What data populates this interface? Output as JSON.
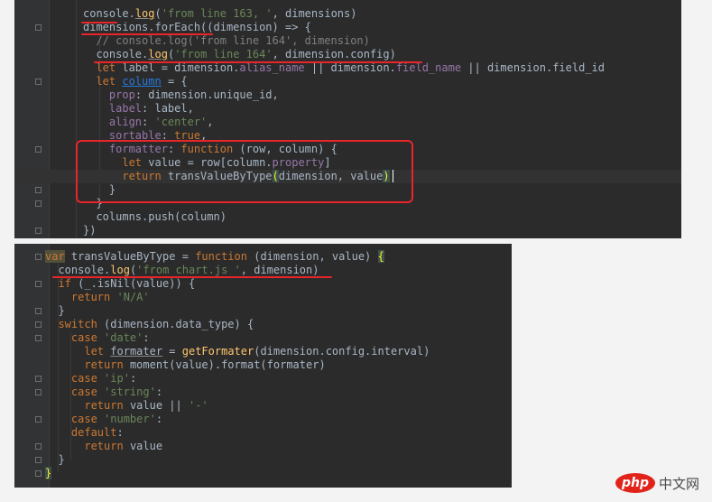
{
  "panels": [
    {
      "id": "top",
      "lines": [
        [
          [
            "plain",
            "console"
          ],
          [
            "plain",
            "."
          ],
          [
            "fn-u",
            "log"
          ],
          [
            "plain",
            "("
          ],
          [
            "str",
            "'from line 163, '"
          ],
          [
            "plain",
            ", dimensions)"
          ]
        ],
        [
          [
            "plain",
            "dimensions.forEach((dimension) => {"
          ]
        ],
        [
          [
            "cm",
            "  // console.log('from line 164', dimension)"
          ]
        ],
        [
          [
            "plain",
            "  "
          ],
          [
            "plain",
            "console"
          ],
          [
            "plain",
            "."
          ],
          [
            "fn-u",
            "log"
          ],
          [
            "plain",
            "("
          ],
          [
            "str",
            "'from line 164'"
          ],
          [
            "plain",
            ", dimension.config)"
          ]
        ],
        [
          [
            "plain",
            "  "
          ],
          [
            "kw",
            "let "
          ],
          [
            "plain",
            "label = dimension."
          ],
          [
            "prop",
            "alias_name"
          ],
          [
            "plain",
            " || dimension."
          ],
          [
            "prop",
            "field_name"
          ],
          [
            "plain",
            " || dimension.field_id"
          ]
        ],
        [
          [
            "plain",
            "  "
          ],
          [
            "kw",
            "let "
          ],
          [
            "link",
            "column"
          ],
          [
            "plain",
            " = {"
          ]
        ],
        [
          [
            "plain",
            "    "
          ],
          [
            "prop",
            "prop"
          ],
          [
            "plain",
            ": dimension.unique_id,"
          ]
        ],
        [
          [
            "plain",
            "    "
          ],
          [
            "prop",
            "label"
          ],
          [
            "plain",
            ": label,"
          ]
        ],
        [
          [
            "plain",
            "    "
          ],
          [
            "prop",
            "align"
          ],
          [
            "plain",
            ": "
          ],
          [
            "str",
            "'center'"
          ],
          [
            "plain",
            ","
          ]
        ],
        [
          [
            "plain",
            "    "
          ],
          [
            "prop",
            "sortable"
          ],
          [
            "plain",
            ": "
          ],
          [
            "kw",
            "true"
          ],
          [
            "plain",
            ","
          ]
        ],
        [
          [
            "plain",
            "    "
          ],
          [
            "prop",
            "formatter"
          ],
          [
            "plain",
            ": "
          ],
          [
            "kw",
            "function "
          ],
          [
            "plain",
            "(row, column) {"
          ]
        ],
        [
          [
            "plain",
            "      "
          ],
          [
            "kw",
            "let "
          ],
          [
            "plain",
            "value = row[column."
          ],
          [
            "prop",
            "property"
          ],
          [
            "plain",
            "]"
          ]
        ],
        [
          [
            "plain",
            "      "
          ],
          [
            "kw",
            "return "
          ],
          [
            "plain",
            "transValueByType"
          ],
          [
            "hl",
            "("
          ],
          [
            "plain",
            "dimension, value"
          ],
          [
            "hl",
            ")"
          ]
        ],
        [
          [
            "plain",
            "    }"
          ]
        ],
        [
          [
            "plain",
            "  }"
          ]
        ],
        [
          [
            "plain",
            "  columns.push(column)"
          ]
        ],
        [
          [
            "plain",
            "})"
          ]
        ]
      ]
    },
    {
      "id": "bottom",
      "lines": [
        [
          [
            "kw-warn",
            "var"
          ],
          [
            "plain",
            " transValueByType = "
          ],
          [
            "kw",
            "function "
          ],
          [
            "plain",
            "(dimension, value) "
          ],
          [
            "hl",
            "{"
          ]
        ],
        [
          [
            "plain",
            "  console."
          ],
          [
            "fn",
            "log"
          ],
          [
            "plain",
            "("
          ],
          [
            "str",
            "'from chart.js '"
          ],
          [
            "plain",
            ", dimension)"
          ]
        ],
        [
          [
            "plain",
            "  "
          ],
          [
            "kw",
            "if "
          ],
          [
            "plain",
            "(_.isNil(value)) {"
          ]
        ],
        [
          [
            "plain",
            "    "
          ],
          [
            "kw",
            "return "
          ],
          [
            "str",
            "'N/A'"
          ]
        ],
        [
          [
            "plain",
            "  }"
          ]
        ],
        [
          [
            "plain",
            "  "
          ],
          [
            "kw",
            "switch "
          ],
          [
            "plain",
            "(dimension.data_type) {"
          ]
        ],
        [
          [
            "plain",
            "    "
          ],
          [
            "kw",
            "case "
          ],
          [
            "str",
            "'date'"
          ],
          [
            "plain",
            ":"
          ]
        ],
        [
          [
            "plain",
            "      "
          ],
          [
            "kw",
            "let "
          ],
          [
            "plain-u",
            "formater"
          ],
          [
            "plain",
            " = "
          ],
          [
            "fn",
            "getFormater"
          ],
          [
            "plain",
            "(dimension.config.interval)"
          ]
        ],
        [
          [
            "plain",
            "      "
          ],
          [
            "kw",
            "return "
          ],
          [
            "plain",
            "moment(value).format(formater)"
          ]
        ],
        [
          [
            "plain",
            "    "
          ],
          [
            "kw",
            "case "
          ],
          [
            "str",
            "'ip'"
          ],
          [
            "plain",
            ":"
          ]
        ],
        [
          [
            "plain",
            "    "
          ],
          [
            "kw",
            "case "
          ],
          [
            "str",
            "'string'"
          ],
          [
            "plain",
            ":"
          ]
        ],
        [
          [
            "plain",
            "      "
          ],
          [
            "kw",
            "return "
          ],
          [
            "plain",
            "value || "
          ],
          [
            "str",
            "'-'"
          ]
        ],
        [
          [
            "plain",
            "    "
          ],
          [
            "kw",
            "case "
          ],
          [
            "str",
            "'number'"
          ],
          [
            "plain",
            ":"
          ]
        ],
        [
          [
            "plain",
            "    "
          ],
          [
            "kw",
            "default"
          ],
          [
            "plain",
            ":"
          ]
        ],
        [
          [
            "plain",
            "      "
          ],
          [
            "kw",
            "return "
          ],
          [
            "plain",
            "value"
          ]
        ],
        [
          [
            "plain",
            "  }"
          ]
        ],
        [
          [
            "hl",
            "}"
          ]
        ]
      ]
    }
  ],
  "watermark": {
    "logo_text": "php",
    "site_text": "中文网"
  },
  "colors": {
    "editor_bg": "#2b2b2b",
    "keyword": "#cc7832",
    "string": "#6a8759",
    "property": "#9876aa",
    "function": "#ffc66d",
    "comment": "#808080",
    "annotation_red": "#e8252a"
  }
}
